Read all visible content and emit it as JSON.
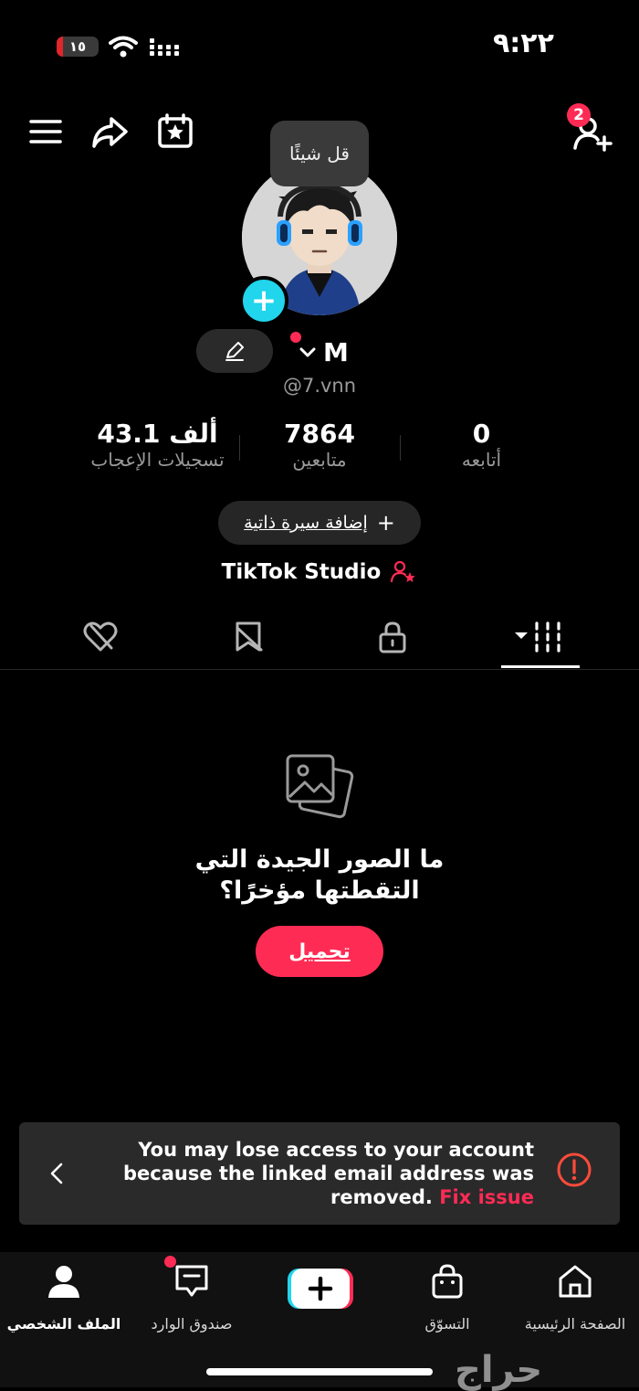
{
  "status_bar": {
    "time": "٩:٢٢",
    "battery_level": "١٥",
    "battery_fraction": 0.15
  },
  "top_bar": {
    "notification_count": "2"
  },
  "tooltip": {
    "text": "قل شيئًا"
  },
  "profile": {
    "name": "M",
    "username": "@7.vnn"
  },
  "stats": [
    {
      "value": "0",
      "label": "أتابعه"
    },
    {
      "value": "7864",
      "label": "متابعين"
    },
    {
      "value": "43.1 ألف",
      "label": "تسجيلات الإعجاب"
    }
  ],
  "add_bio_label": "إضافة سيرة ذاتية",
  "studio_label": "TikTok Studio",
  "empty_state": {
    "title_line1": "ما الصور الجيدة التي",
    "title_line2": "التقطتها مؤخرًا؟",
    "upload_label": "تحميل"
  },
  "banner": {
    "message": "You may lose access to your account because the linked email address was removed.",
    "fix_label": "Fix issue"
  },
  "bottom_nav": {
    "home": "الصفحة الرئيسية",
    "shop": "التسوّق",
    "inbox": "صندوق الوارد",
    "profile": "الملف الشخصي"
  },
  "watermark": "حراج",
  "colors": {
    "accent": "#fe2c55",
    "cyan": "#20d5ec",
    "banner_bg": "#2a2a2a"
  }
}
